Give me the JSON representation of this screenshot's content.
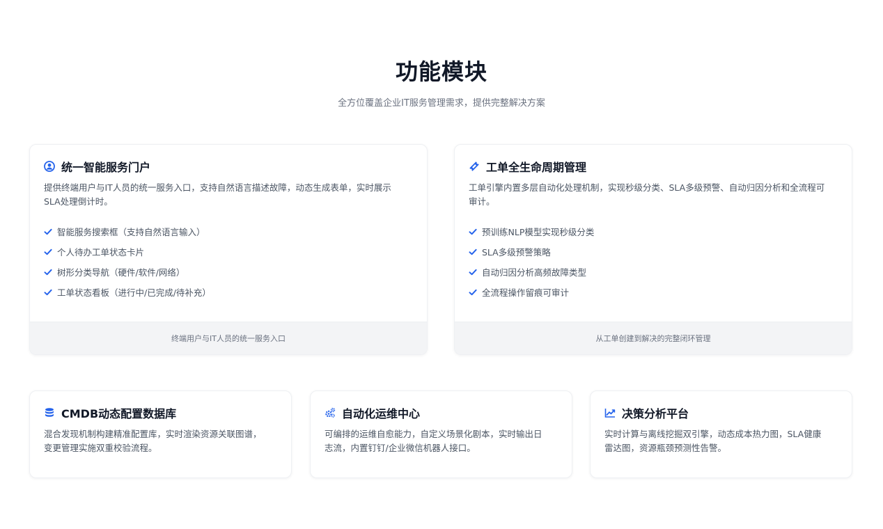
{
  "section": {
    "title": "功能模块",
    "subtitle": "全方位覆盖企业IT服务管理需求，提供完整解决方案"
  },
  "colors": {
    "accent": "#2563eb",
    "title": "#111827",
    "text": "#4b5563",
    "muted": "#6b7280",
    "footer_bg": "#f3f4f6"
  },
  "cards_main": [
    {
      "icon": "user-circle-icon",
      "title": "统一智能服务门户",
      "description": "提供终端用户与IT人员的统一服务入口，支持自然语言描述故障，动态生成表单，实时展示SLA处理倒计时。",
      "features": [
        "智能服务搜索框（支持自然语言输入）",
        "个人待办工单状态卡片",
        "树形分类导航（硬件/软件/网络）",
        "工单状态看板（进行中/已完成/待补充）"
      ],
      "footer": "终端用户与IT人员的统一服务入口"
    },
    {
      "icon": "ticket-icon",
      "title": "工单全生命周期管理",
      "description": "工单引擎内置多层自动化处理机制，实现秒级分类、SLA多级预警、自动归因分析和全流程可审计。",
      "features": [
        "预训练NLP模型实现秒级分类",
        "SLA多级预警策略",
        "自动归因分析高频故障类型",
        "全流程操作留痕可审计"
      ],
      "footer": "从工单创建到解决的完整闭环管理"
    }
  ],
  "cards_secondary": [
    {
      "icon": "database-icon",
      "title": "CMDB动态配置数据库",
      "description": "混合发现机制构建精准配置库，实时渲染资源关联图谱，变更管理实施双重校验流程。"
    },
    {
      "icon": "gears-icon",
      "title": "自动化运维中心",
      "description": "可编排的运维自愈能力，自定义场景化剧本，实时输出日志流，内置钉钉/企业微信机器人接口。"
    },
    {
      "icon": "line-chart-icon",
      "title": "决策分析平台",
      "description": "实时计算与离线挖掘双引擎，动态成本热力图，SLA健康雷达图，资源瓶颈预测性告警。"
    }
  ]
}
